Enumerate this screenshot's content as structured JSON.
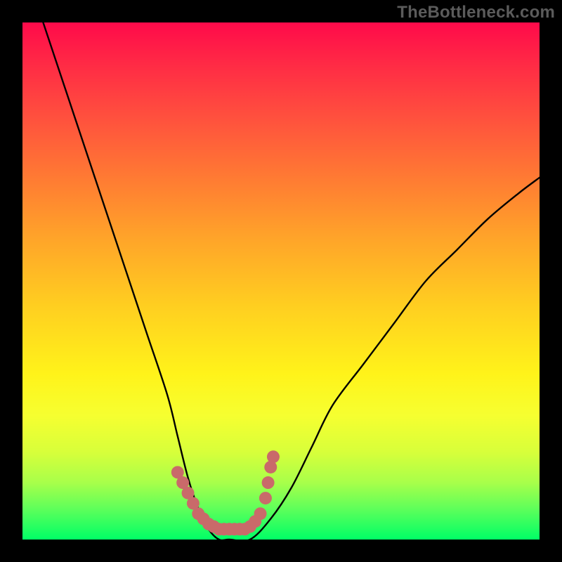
{
  "watermark": "TheBottleneck.com",
  "chart_data": {
    "type": "line",
    "title": "",
    "xlabel": "",
    "ylabel": "",
    "xlim": [
      0,
      100
    ],
    "ylim": [
      0,
      100
    ],
    "series": [
      {
        "name": "bottleneck-curve",
        "x": [
          4,
          8,
          12,
          16,
          20,
          24,
          28,
          30,
          32,
          34,
          36,
          38,
          40,
          44,
          48,
          52,
          56,
          60,
          66,
          72,
          78,
          84,
          90,
          96,
          100
        ],
        "y": [
          100,
          88,
          76,
          64,
          52,
          40,
          28,
          20,
          12,
          6,
          2,
          0,
          0,
          0,
          4,
          10,
          18,
          26,
          34,
          42,
          50,
          56,
          62,
          67,
          70
        ]
      }
    ],
    "annotations": [
      {
        "name": "dot-cluster",
        "type": "scatter",
        "color": "#c96a6a",
        "x": [
          30,
          31,
          32,
          33,
          34,
          35,
          36,
          37,
          38,
          39,
          40,
          41,
          42,
          43,
          44,
          45,
          46,
          47,
          47.5,
          48,
          48.5
        ],
        "y": [
          13,
          11,
          9,
          7,
          5,
          4,
          3,
          2.5,
          2,
          2,
          2,
          2,
          2,
          2,
          2.5,
          3.5,
          5,
          8,
          11,
          14,
          16
        ]
      }
    ]
  }
}
